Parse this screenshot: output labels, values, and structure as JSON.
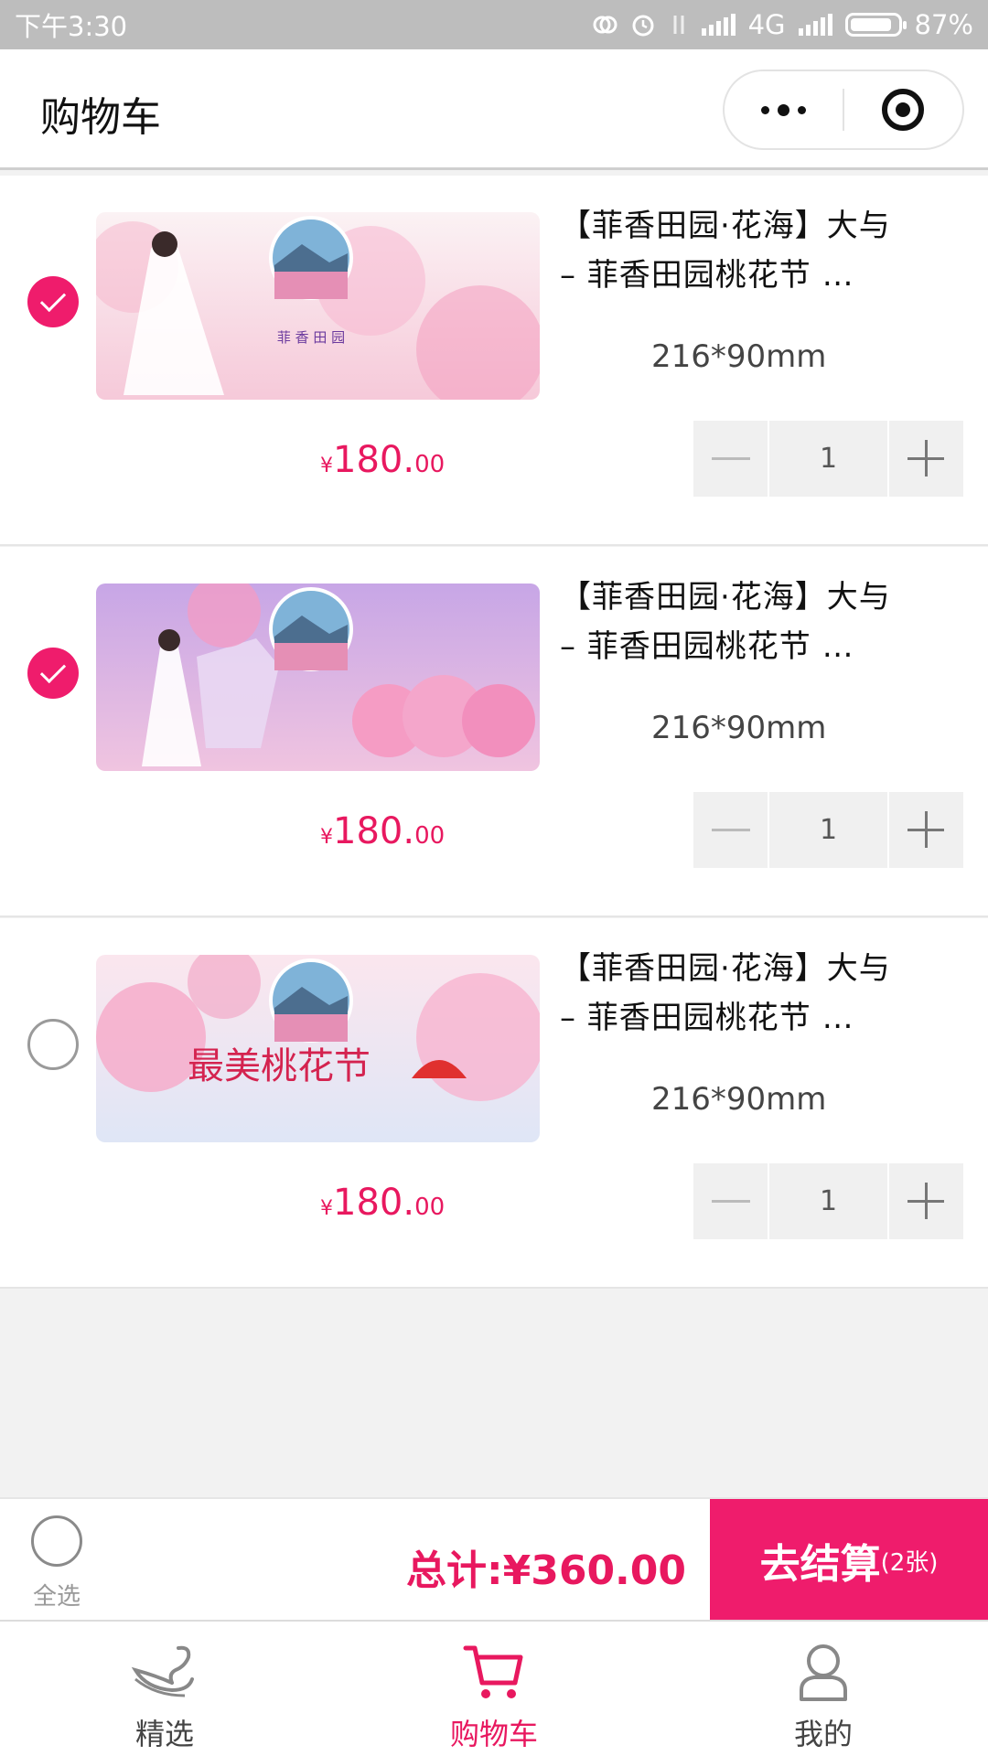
{
  "status_bar": {
    "time": "下午3:30",
    "network": "4G",
    "battery": "87%",
    "battery_level": 0.87
  },
  "header": {
    "title": "购物车",
    "menu_icon": "more-dots-icon",
    "close_icon": "target-close-icon"
  },
  "cart": {
    "items": [
      {
        "checked": true,
        "name_line1": "【菲香田园·花海】大与",
        "name_line2": "– 菲香田园桃花节 …",
        "spec": "216*90mm",
        "currency": "¥",
        "price_int": "180.",
        "price_dec": "00",
        "qty": "1"
      },
      {
        "checked": true,
        "name_line1": "【菲香田园·花海】大与",
        "name_line2": "– 菲香田园桃花节 …",
        "spec": "216*90mm",
        "currency": "¥",
        "price_int": "180.",
        "price_dec": "00",
        "qty": "1"
      },
      {
        "checked": false,
        "name_line1": "【菲香田园·花海】大与",
        "name_line2": "– 菲香田园桃花节 …",
        "spec": "216*90mm",
        "currency": "¥",
        "price_int": "180.",
        "price_dec": "00",
        "qty": "1"
      }
    ]
  },
  "checkout": {
    "select_all": "全选",
    "total": "总计:¥360.00",
    "button": "去结算",
    "button_count": "(2张)"
  },
  "tabs": [
    {
      "label": "精选",
      "icon": "swan-icon",
      "active": false
    },
    {
      "label": "购物车",
      "icon": "cart-icon",
      "active": true
    },
    {
      "label": "我的",
      "icon": "user-icon",
      "active": false
    }
  ],
  "colors": {
    "accent": "#ef1c6c",
    "price": "#e8185f"
  }
}
